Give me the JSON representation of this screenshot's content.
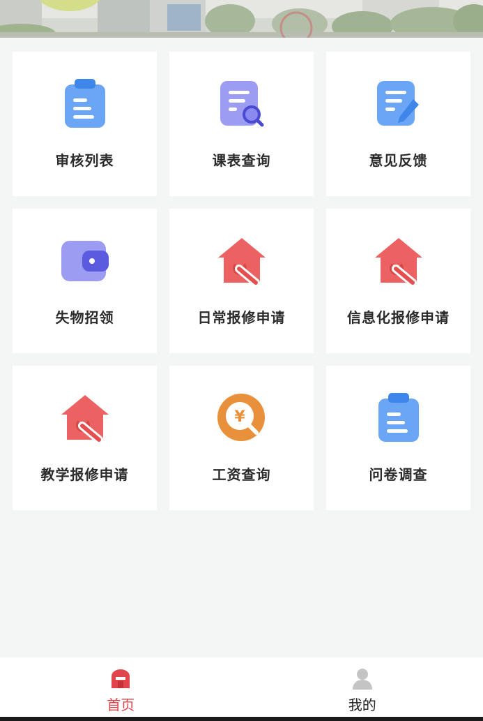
{
  "colors": {
    "accent": "#d9434a",
    "blue_icon": "#5b9bf0",
    "purple_icon": "#8f8ff0",
    "red_icon": "#e85b5b",
    "orange_icon": "#e8913a"
  },
  "grid": {
    "tiles": [
      {
        "label": "审核列表",
        "icon": "clipboard-icon"
      },
      {
        "label": "课表查询",
        "icon": "document-search-icon"
      },
      {
        "label": "意见反馈",
        "icon": "document-edit-icon"
      },
      {
        "label": "失物招领",
        "icon": "wallet-icon"
      },
      {
        "label": "日常报修申请",
        "icon": "house-wrench-icon"
      },
      {
        "label": "信息化报修申请",
        "icon": "house-wrench-icon"
      },
      {
        "label": "教学报修申请",
        "icon": "house-wrench-icon"
      },
      {
        "label": "工资查询",
        "icon": "yen-search-icon"
      },
      {
        "label": "问卷调查",
        "icon": "clipboard-icon"
      }
    ]
  },
  "tabbar": {
    "home_label": "首页",
    "home_icon": "home-icon",
    "mine_label": "我的",
    "mine_icon": "user-icon"
  }
}
